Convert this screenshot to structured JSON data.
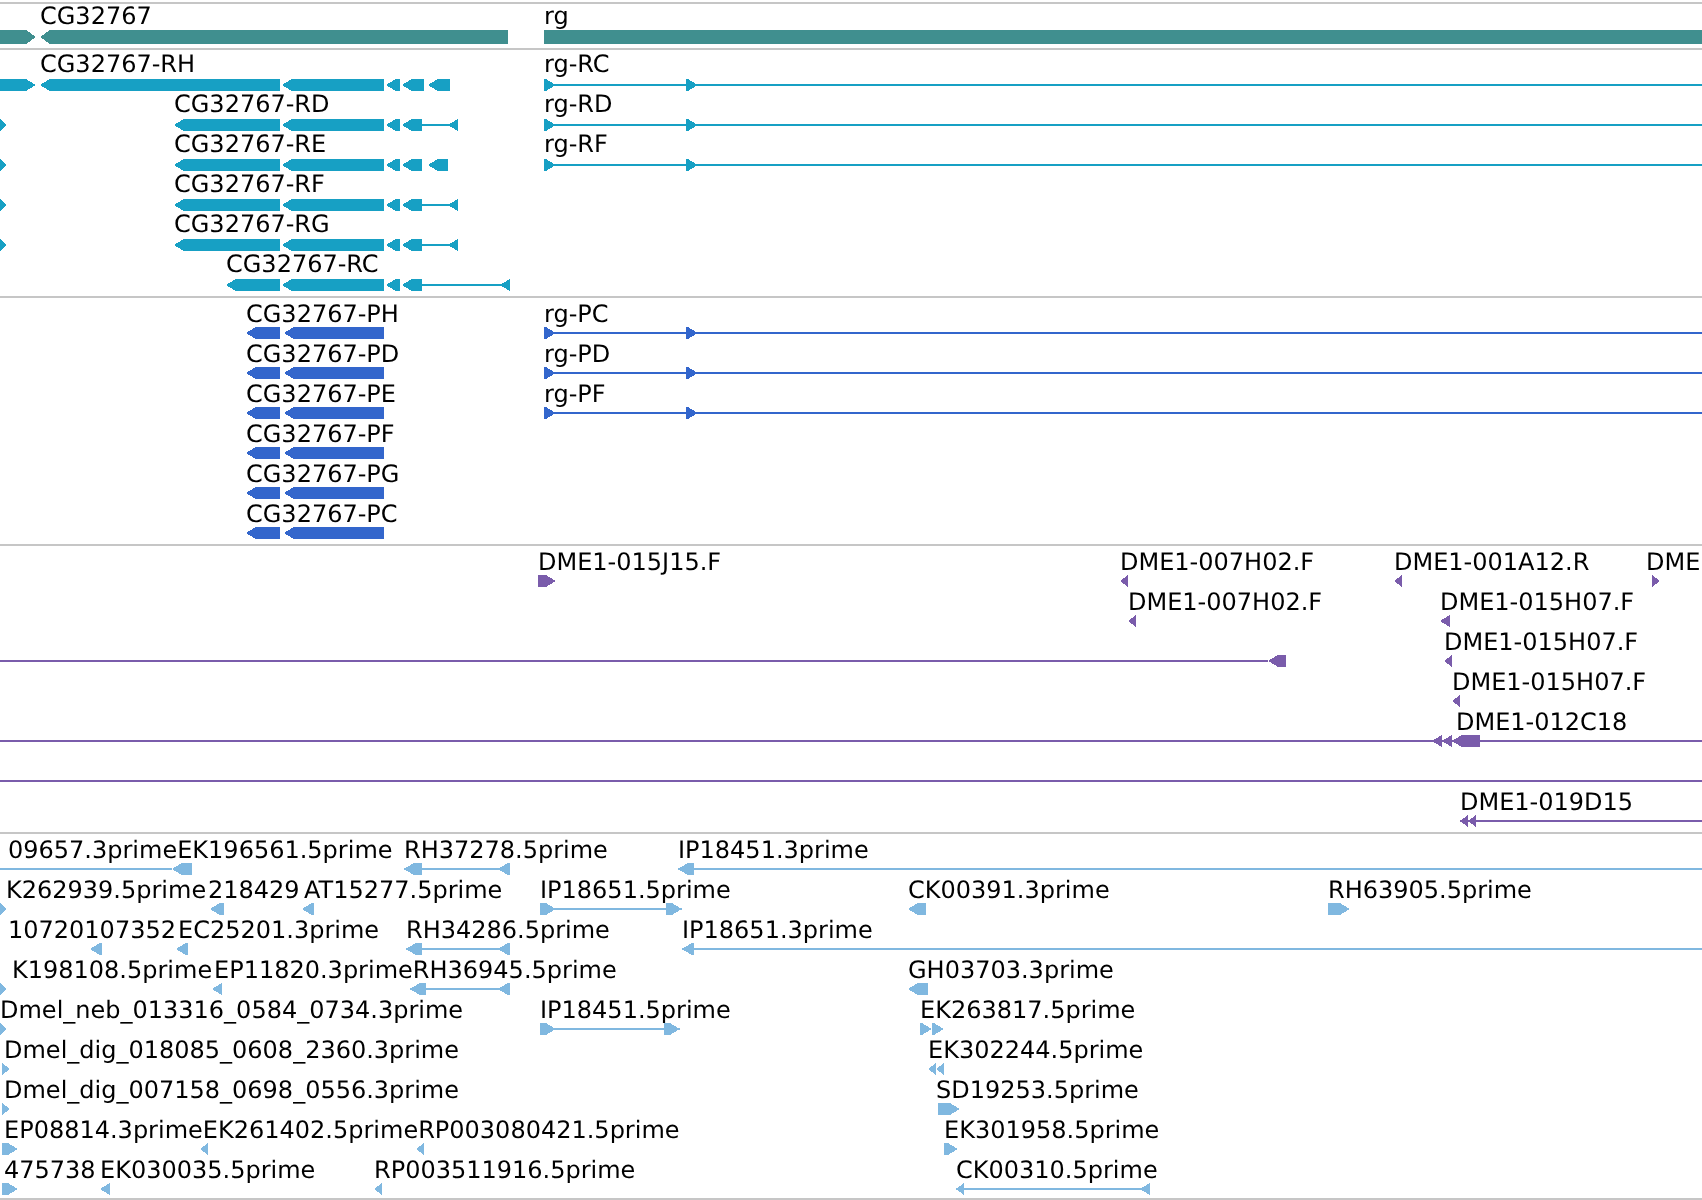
{
  "tracks": [
    {
      "color": "#408f8f",
      "features": [
        {
          "reverse": false
        },
        {
          "label": "CG32767",
          "reverse": true
        },
        {
          "label": "rg",
          "reverse": false
        }
      ]
    },
    {
      "color": "#17a0c4",
      "features": [
        {
          "reverse": false
        },
        {
          "label": "CG32767-RH",
          "reverse": true
        },
        {
          "label": "rg-RC",
          "reverse": false
        },
        {
          "reverse": false
        },
        {
          "label": "CG32767-RD",
          "reverse": true
        },
        {
          "label": "rg-RD",
          "reverse": false
        },
        {
          "reverse": false
        },
        {
          "label": "CG32767-RE",
          "reverse": true
        },
        {
          "label": "rg-RF",
          "reverse": false
        },
        {
          "reverse": false
        },
        {
          "label": "CG32767-RF",
          "reverse": true
        },
        {
          "reverse": false
        },
        {
          "label": "CG32767-RG",
          "reverse": true
        },
        {
          "label": "CG32767-RC",
          "reverse": true
        }
      ]
    },
    {
      "color": "#3366cc",
      "features": [
        {
          "label": "CG32767-PH",
          "reverse": true
        },
        {
          "label": "rg-PC",
          "reverse": false
        },
        {
          "label": "CG32767-PD",
          "reverse": true
        },
        {
          "label": "rg-PD",
          "reverse": false
        },
        {
          "label": "CG32767-PE",
          "reverse": true
        },
        {
          "label": "rg-PF",
          "reverse": false
        },
        {
          "label": "CG32767-PF",
          "reverse": true
        },
        {
          "label": "CG32767-PG",
          "reverse": true
        },
        {
          "label": "CG32767-PC",
          "reverse": true
        }
      ]
    },
    {
      "color": "#7a5cab",
      "features": [
        {
          "label": "DME1-015J15.F",
          "reverse": false
        },
        {
          "label": "DME1-007H02.F",
          "reverse": true
        },
        {
          "label": "DME1-001A12.R",
          "reverse": true
        },
        {
          "label": "DME",
          "reverse": false
        },
        {
          "label": "DME1-007H02.F",
          "reverse": true
        },
        {
          "label": "DME1-015H07.F",
          "reverse": true
        },
        {
          "reverse": true
        },
        {
          "label": "DME1-015H07.F",
          "reverse": true
        },
        {
          "label": "DME1-015H07.F",
          "reverse": true
        },
        {
          "label": "DME1-012C18",
          "reverse": true
        },
        {
          "kind": "line"
        },
        {
          "label": "DME1-019D15",
          "reverse": true
        }
      ]
    },
    {
      "color": "#80b8e0",
      "features": [
        {
          "label": "09657.3prime",
          "kind": "line"
        },
        {
          "label": "EK196561.5prime",
          "reverse": true
        },
        {
          "label": "RH37278.5prime",
          "reverse": true
        },
        {
          "label": "IP18451.3prime",
          "reverse": true
        },
        {
          "label": "K262939.5prime",
          "reverse": false
        },
        {
          "label": "218429",
          "reverse": true
        },
        {
          "label": "AT15277.5prime",
          "reverse": true
        },
        {
          "label": "IP18651.5prime",
          "reverse": false
        },
        {
          "label": "CK00391.3prime",
          "reverse": true
        },
        {
          "label": "RH63905.5prime",
          "reverse": false
        },
        {
          "label": "10720107352",
          "reverse": true
        },
        {
          "label": "EC25201.3prime",
          "reverse": true
        },
        {
          "label": "RH34286.5prime",
          "reverse": true
        },
        {
          "label": "IP18651.3prime",
          "reverse": true
        },
        {
          "label": "K198108.5prime",
          "reverse": false
        },
        {
          "label": "EP11820.3prime",
          "reverse": true
        },
        {
          "label": "RH36945.5prime",
          "reverse": true
        },
        {
          "label": "GH03703.3prime",
          "reverse": true
        },
        {
          "label": "Dmel_neb_013316_0584_0734.3prime",
          "reverse": false
        },
        {
          "label": "IP18451.5prime",
          "reverse": false
        },
        {
          "label": "EK263817.5prime",
          "reverse": false
        },
        {
          "label": "Dmel_dig_018085_0608_2360.3prime",
          "reverse": false
        },
        {
          "label": "EK302244.5prime",
          "reverse": true
        },
        {
          "label": "Dmel_dig_007158_0698_0556.3prime",
          "reverse": false
        },
        {
          "label": "SD19253.5prime",
          "reverse": false
        },
        {
          "label": "EP08814.3prime",
          "reverse": false
        },
        {
          "label": "EK261402.5prime",
          "reverse": true
        },
        {
          "label": "RP003080421.5prime",
          "reverse": true
        },
        {
          "label": "EK301958.5prime",
          "reverse": false
        },
        {
          "label": "475738",
          "reverse": false
        },
        {
          "label": "EK030035.5prime",
          "reverse": true
        },
        {
          "label": "RP003511916.5prime",
          "reverse": true
        },
        {
          "label": "CK00310.5prime",
          "reverse": true
        }
      ]
    }
  ]
}
